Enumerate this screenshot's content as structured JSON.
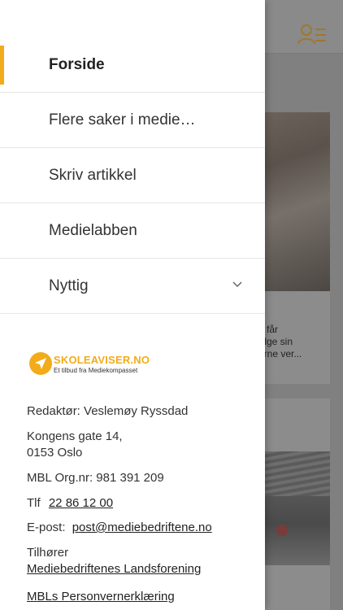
{
  "menu": {
    "items": [
      {
        "label": "Forside",
        "active": true
      },
      {
        "label": "Flere saker i medie…"
      },
      {
        "label": "Skriv artikkel"
      },
      {
        "label": "Medielabben"
      },
      {
        "label": "Nyttig",
        "expandable": true
      }
    ]
  },
  "logo": {
    "title": "SKOLEAVISER.NO",
    "subtitle": "Et tilbud fra Mediekompasset"
  },
  "info": {
    "editor": "Redaktør: Veslemøy Ryssdad",
    "address_line1": "Kongens gate 14,",
    "address_line2": "0153 Oslo",
    "org": "MBL Org.nr: 981 391 209",
    "phone_label": "Tlf",
    "phone": "22 86 12 00",
    "email_label": "E-post:",
    "email": "post@mediebedriftene.no",
    "belongs_label": "Tilhører",
    "belongs_link": "Mediebedriftenes Landsforening",
    "privacy_link": "MBLs Personvernerklæring"
  },
  "background": {
    "card_snippet": "n får\nølge sin\nerne ver..."
  },
  "colors": {
    "accent": "#f2ac19",
    "overlay": "#808080"
  }
}
